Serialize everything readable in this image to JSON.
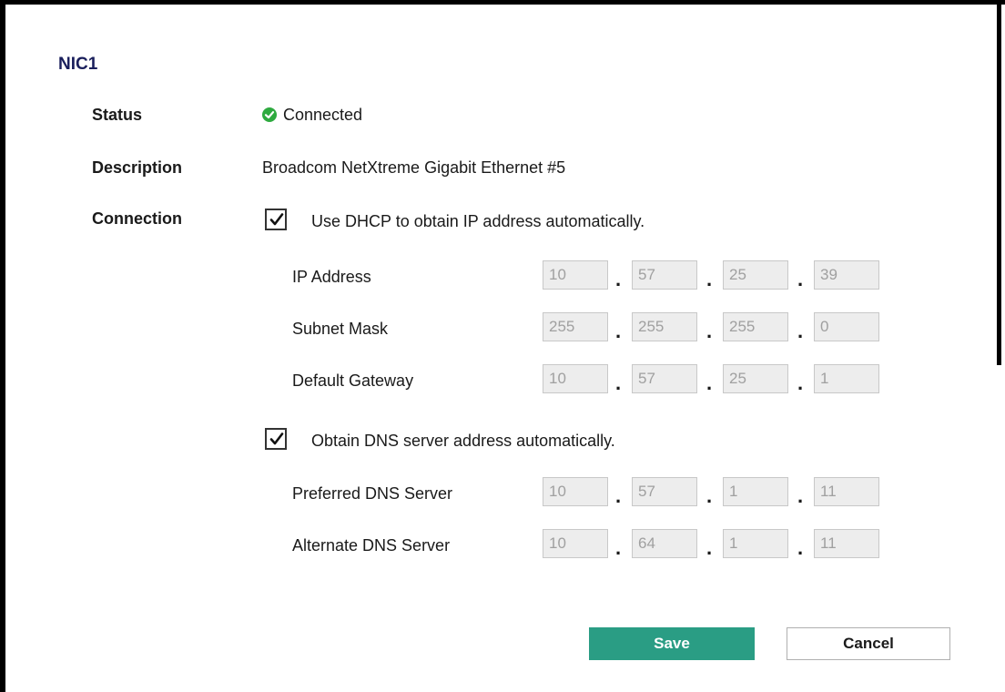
{
  "nic": {
    "title": "NIC1",
    "status_label": "Status",
    "status_value": "Connected",
    "status_color": "#2eaa3f",
    "description_label": "Description",
    "description_value": "Broadcom NetXtreme Gigabit Ethernet #5",
    "connection_label": "Connection"
  },
  "dhcp": {
    "label": "Use DHCP to obtain IP address automatically.",
    "checked": true,
    "fields": [
      {
        "label": "IP Address",
        "octets": [
          "10",
          "57",
          "25",
          "39"
        ]
      },
      {
        "label": "Subnet Mask",
        "octets": [
          "255",
          "255",
          "255",
          "0"
        ]
      },
      {
        "label": "Default Gateway",
        "octets": [
          "10",
          "57",
          "25",
          "1"
        ]
      }
    ]
  },
  "dns": {
    "label": "Obtain DNS server address automatically.",
    "checked": true,
    "fields": [
      {
        "label": "Preferred DNS Server",
        "octets": [
          "10",
          "57",
          "1",
          "11"
        ]
      },
      {
        "label": "Alternate DNS Server",
        "octets": [
          "10",
          "64",
          "1",
          "11"
        ]
      }
    ]
  },
  "buttons": {
    "save_label": "Save",
    "cancel_label": "Cancel",
    "save_color": "#2a9d84"
  },
  "icons": {
    "status": "check-circle-icon",
    "checkbox": "checkmark-icon"
  }
}
